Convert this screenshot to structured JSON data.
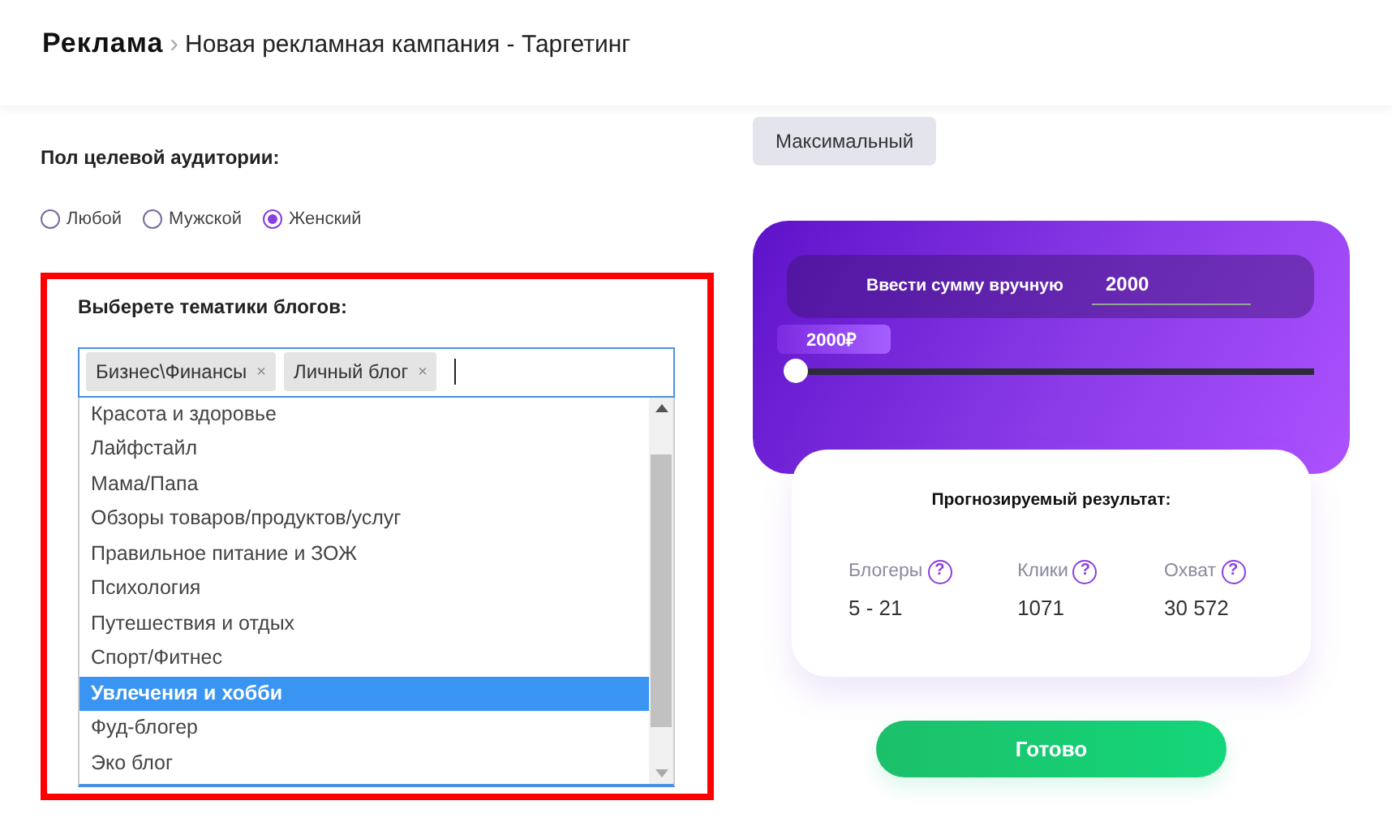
{
  "breadcrumb": {
    "root": "Реклама",
    "separator": "›",
    "current": "Новая рекламная кампания - Таргетинг"
  },
  "preset_button": {
    "label": "Максимальный"
  },
  "gender": {
    "title": "Пол целевой аудитории:",
    "options": [
      {
        "label": "Любой",
        "selected": false
      },
      {
        "label": "Мужской",
        "selected": false
      },
      {
        "label": "Женский",
        "selected": true
      }
    ]
  },
  "topics": {
    "title": "Выберете тематики блогов:",
    "tags": [
      {
        "label": "Бизнес\\Финансы",
        "remove": "×"
      },
      {
        "label": "Личный блог",
        "remove": "×"
      }
    ],
    "options": [
      {
        "label": "Красота и здоровье",
        "selected": false
      },
      {
        "label": "Лайфстайл",
        "selected": false
      },
      {
        "label": "Мама/Папа",
        "selected": false
      },
      {
        "label": "Обзоры товаров/продуктов/услуг",
        "selected": false
      },
      {
        "label": "Правильное питание и ЗОЖ",
        "selected": false
      },
      {
        "label": "Психология",
        "selected": false
      },
      {
        "label": "Путешествия и отдых",
        "selected": false
      },
      {
        "label": "Спорт/Фитнес",
        "selected": false
      },
      {
        "label": "Увлечения и хобби",
        "selected": true
      },
      {
        "label": "Фуд-блогер",
        "selected": false
      },
      {
        "label": "Эко блог",
        "selected": false
      }
    ]
  },
  "budget": {
    "manual_label": "Ввести сумму вручную",
    "manual_value": "2000",
    "slider_label": "2000₽",
    "level": 0
  },
  "forecast": {
    "title": "Прогнозируемый результат:",
    "stats": [
      {
        "label": "Блогеры",
        "hint": "?",
        "value": "5 - 21"
      },
      {
        "label": "Клики",
        "hint": "?",
        "value": "1071"
      },
      {
        "label": "Охват",
        "hint": "?",
        "value": "30 572"
      }
    ]
  },
  "done_button": {
    "label": "Готово"
  }
}
